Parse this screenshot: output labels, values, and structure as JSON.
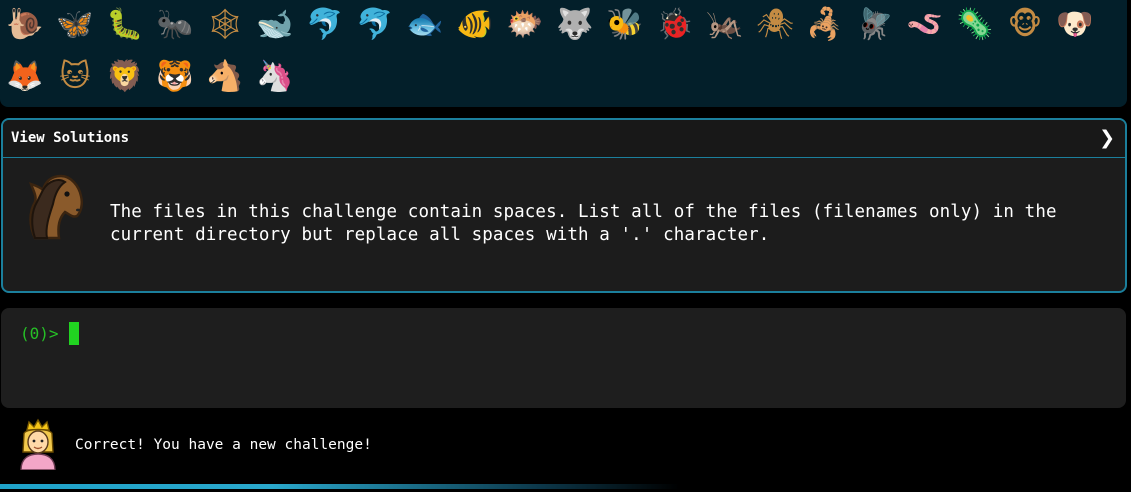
{
  "animals": {
    "row1": [
      {
        "name": "snail",
        "glyph": "🐌"
      },
      {
        "name": "butterfly",
        "glyph": "🦋"
      },
      {
        "name": "caterpillar",
        "glyph": "🐛"
      },
      {
        "name": "ant",
        "glyph": "🐜"
      },
      {
        "name": "spider-web",
        "glyph": "🕸"
      },
      {
        "name": "whale",
        "glyph": "🐋"
      },
      {
        "name": "dolphin-blue",
        "glyph": "🐬"
      },
      {
        "name": "dolphin-grey",
        "glyph": "🐬"
      },
      {
        "name": "fish",
        "glyph": "🐟"
      },
      {
        "name": "tropical-fish",
        "glyph": "🐠"
      },
      {
        "name": "blowfish",
        "glyph": "🐡"
      },
      {
        "name": "wolf",
        "glyph": "🐺"
      },
      {
        "name": "bee",
        "glyph": "🐝"
      },
      {
        "name": "ladybug",
        "glyph": "🐞"
      },
      {
        "name": "cricket",
        "glyph": "🦗"
      },
      {
        "name": "spider",
        "glyph": "🕷"
      },
      {
        "name": "scorpion",
        "glyph": "🦂"
      },
      {
        "name": "fly",
        "glyph": "🪰"
      },
      {
        "name": "worm",
        "glyph": "🪱"
      },
      {
        "name": "microbe",
        "glyph": "🦠"
      },
      {
        "name": "monkey",
        "glyph": "🐵"
      },
      {
        "name": "dog",
        "glyph": "🐶"
      }
    ],
    "row2": [
      {
        "name": "fox",
        "glyph": "🦊"
      },
      {
        "name": "cat",
        "glyph": "🐱"
      },
      {
        "name": "lion",
        "glyph": "🦁"
      },
      {
        "name": "tiger",
        "glyph": "🐯"
      },
      {
        "name": "horse",
        "glyph": "🐴"
      },
      {
        "name": "unicorn",
        "glyph": "🦄"
      }
    ]
  },
  "solutions": {
    "title": "View Solutions",
    "chevron": "❯",
    "challenge": "The files in this challenge contain spaces. List all of the files (filenames only) in the current directory but replace all spaces with a '.' character."
  },
  "terminal": {
    "prompt": "(0)>"
  },
  "status": {
    "message": "Correct! You have a new challenge!",
    "progress": 0.6
  },
  "colors": {
    "accent": "#1b7f9c",
    "prompt": "#26c026",
    "panel": "#1c1c1c",
    "header_bg": "#031f2a"
  }
}
